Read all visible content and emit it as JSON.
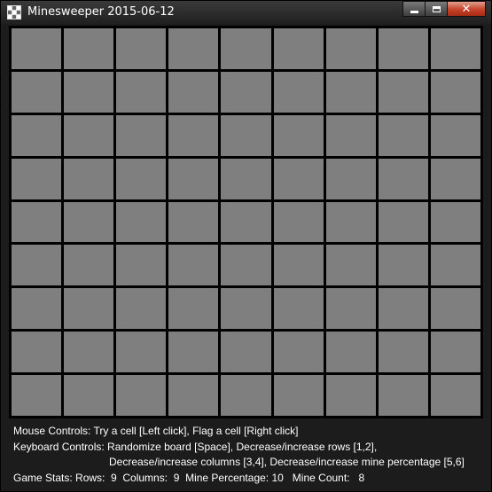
{
  "window": {
    "title": "Minesweeper 2015-06-12",
    "icons": {
      "app": "grid-icon",
      "minimize": "minimize-icon",
      "maximize": "maximize-icon",
      "close": "close-icon"
    },
    "colors": {
      "close": "#c6412a",
      "frame": "#1c1c1c"
    }
  },
  "board": {
    "rows": 9,
    "columns": 9,
    "cell_color": "#7f7f7f",
    "grid_color": "#000000"
  },
  "info": {
    "mouse_line": "Mouse Controls: Try a cell [Left click], Flag a cell [Right click]",
    "keyboard_line1": "Keyboard Controls: Randomize board [Space], Decrease/increase rows [1,2],",
    "keyboard_line2": "Decrease/increase columns [3,4], Decrease/increase mine percentage [5,6]",
    "stats_line": "Game Stats: Rows:  9  Columns:  9  Mine Percentage: 10   Mine Count:   8"
  }
}
